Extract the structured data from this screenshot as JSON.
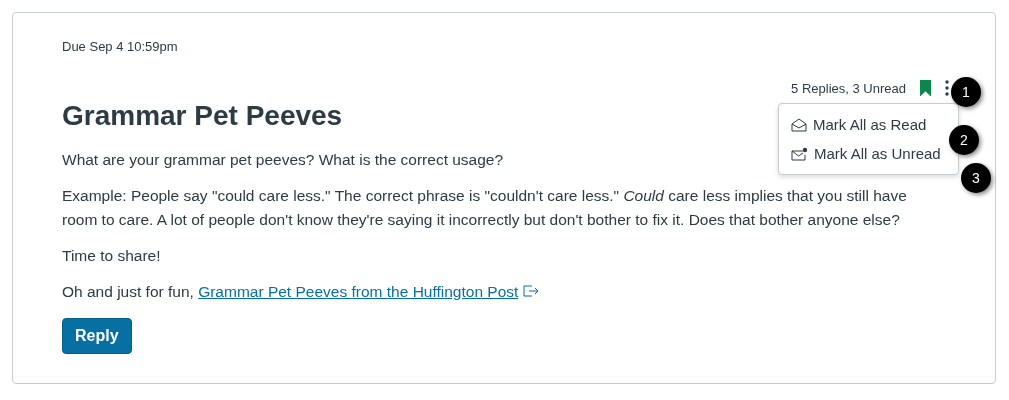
{
  "due": "Due Sep 4 10:59pm",
  "header": {
    "replies": "5 Replies, 3 Unread",
    "bookmarked": true
  },
  "menu": {
    "open": true,
    "items": [
      {
        "kind": "read",
        "label": "Mark All as Read"
      },
      {
        "kind": "unread",
        "label": "Mark All as Unread"
      }
    ]
  },
  "callouts": [
    "1",
    "2",
    "3"
  ],
  "title": "Grammar Pet Peeves",
  "paragraphs": [
    "What are your grammar pet peeves? What is the correct usage?",
    "Example: People say \"could care less.\" The correct phrase is \"couldn't care less.\" *Could* care less implies that you still have room to care. A lot of people don't know they're saying it incorrectly but don't bother to fix it. Does that bother anyone else?",
    "Time to share!"
  ],
  "link_paragraph": {
    "text": "Oh and just for fun, ",
    "link": "Grammar Pet Peeves from the Huffington Post"
  },
  "reply_button": "Reply"
}
